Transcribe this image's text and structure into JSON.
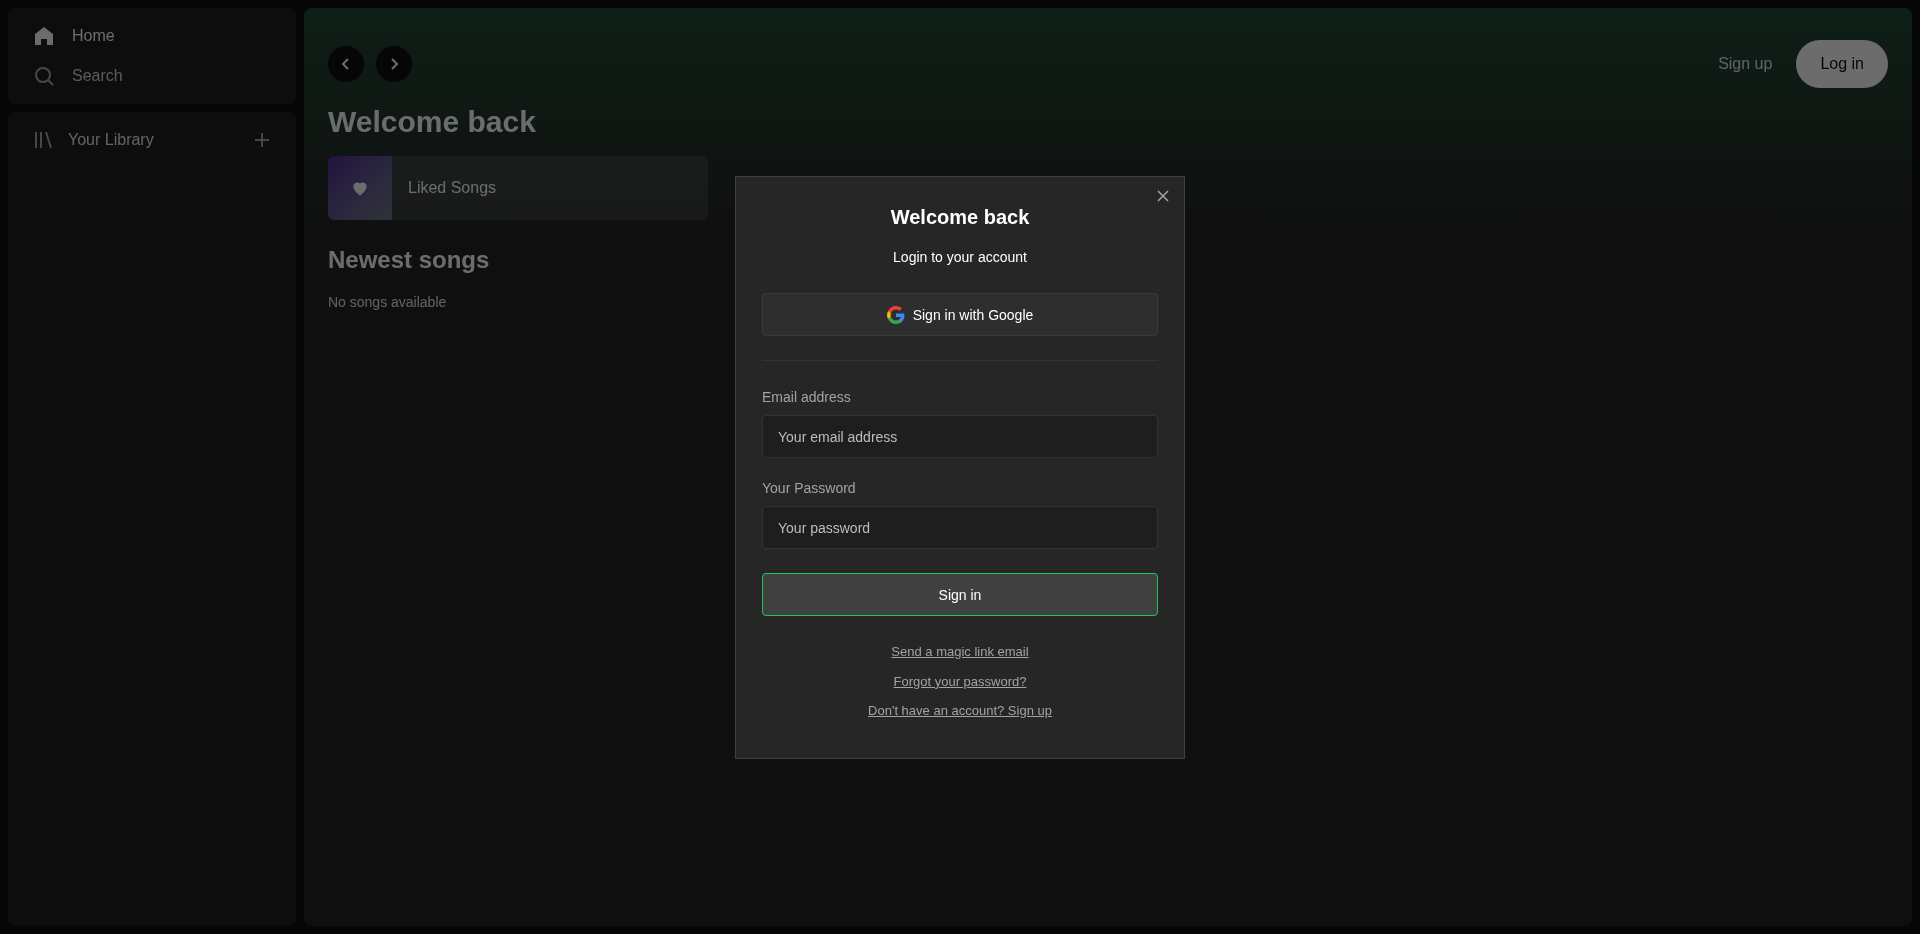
{
  "sidebar": {
    "nav": [
      {
        "label": "Home",
        "kind": "home",
        "selected": true
      },
      {
        "label": "Search",
        "kind": "search",
        "selected": false
      }
    ],
    "library": {
      "label": "Your Library"
    }
  },
  "header": {
    "signup": "Sign up",
    "login": "Log in"
  },
  "main": {
    "greeting": "Welcome back",
    "liked": "Liked Songs",
    "section_title": "Newest songs",
    "empty": "No songs available"
  },
  "modal": {
    "title": "Welcome back",
    "subtitle": "Login to your account",
    "google_button": "Sign in with Google",
    "fields": [
      {
        "label": "Email address",
        "placeholder": "Your email address"
      },
      {
        "label": "Your Password",
        "placeholder": "Your password"
      }
    ],
    "submit": "Sign in",
    "links": [
      "Send a magic link email",
      "Forgot your password?",
      "Don't have an account? Sign up"
    ]
  }
}
